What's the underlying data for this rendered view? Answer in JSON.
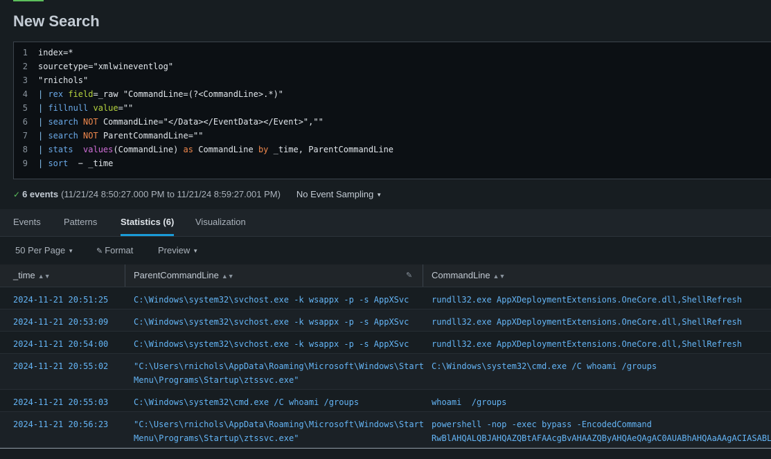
{
  "page": {
    "title": "New Search"
  },
  "query_lines": [
    [
      {
        "t": "index=*",
        "c": "tk-plain"
      }
    ],
    [
      {
        "t": "sourcetype=\"xmlwineventlog\"",
        "c": "tk-plain"
      }
    ],
    [
      {
        "t": "\"rnichols\"",
        "c": "tk-plain"
      }
    ],
    [
      {
        "t": "| ",
        "c": "tk-pipe"
      },
      {
        "t": "rex ",
        "c": "tk-cmd"
      },
      {
        "t": "field",
        "c": "tk-arg"
      },
      {
        "t": "=_raw \"CommandLine=(?<CommandLine>.*)\"",
        "c": "tk-plain"
      }
    ],
    [
      {
        "t": "| ",
        "c": "tk-pipe"
      },
      {
        "t": "fillnull ",
        "c": "tk-cmd"
      },
      {
        "t": "value",
        "c": "tk-arg"
      },
      {
        "t": "=\"\"",
        "c": "tk-plain"
      }
    ],
    [
      {
        "t": "| ",
        "c": "tk-pipe"
      },
      {
        "t": "search ",
        "c": "tk-cmd"
      },
      {
        "t": "NOT ",
        "c": "tk-kw"
      },
      {
        "t": "CommandLine=\"</Data></EventData></Event>\",\"\"",
        "c": "tk-plain"
      }
    ],
    [
      {
        "t": "| ",
        "c": "tk-pipe"
      },
      {
        "t": "search ",
        "c": "tk-cmd"
      },
      {
        "t": "NOT ",
        "c": "tk-kw"
      },
      {
        "t": "ParentCommandLine=\"\"",
        "c": "tk-plain"
      }
    ],
    [
      {
        "t": "| ",
        "c": "tk-pipe"
      },
      {
        "t": "stats  ",
        "c": "tk-cmd"
      },
      {
        "t": "values",
        "c": "tk-fn"
      },
      {
        "t": "(CommandLine) ",
        "c": "tk-plain"
      },
      {
        "t": "as ",
        "c": "tk-kw"
      },
      {
        "t": "CommandLine ",
        "c": "tk-plain"
      },
      {
        "t": "by ",
        "c": "tk-kw"
      },
      {
        "t": "_time, ParentCommandLine",
        "c": "tk-plain"
      }
    ],
    [
      {
        "t": "| ",
        "c": "tk-pipe"
      },
      {
        "t": "sort ",
        "c": "tk-cmd"
      },
      {
        "t": " − _time",
        "c": "tk-plain"
      }
    ]
  ],
  "summary": {
    "events": "6 events",
    "range": "(11/21/24 8:50:27.000 PM to 11/21/24 8:59:27.001 PM)",
    "sampling": "No Event Sampling"
  },
  "tabs": [
    "Events",
    "Patterns",
    "Statistics (6)",
    "Visualization"
  ],
  "active_tab": "Statistics (6)",
  "toolbar": {
    "per_page": "50 Per Page",
    "format": "Format",
    "preview": "Preview"
  },
  "table": {
    "columns": [
      "_time",
      "ParentCommandLine",
      "CommandLine"
    ],
    "rows": [
      {
        "time": "2024-11-21 20:51:25",
        "parent": "C:\\Windows\\system32\\svchost.exe -k wsappx -p -s AppXSvc",
        "cmd": "rundll32.exe AppXDeploymentExtensions.OneCore.dll,ShellRefresh"
      },
      {
        "time": "2024-11-21 20:53:09",
        "parent": "C:\\Windows\\system32\\svchost.exe -k wsappx -p -s AppXSvc",
        "cmd": "rundll32.exe AppXDeploymentExtensions.OneCore.dll,ShellRefresh"
      },
      {
        "time": "2024-11-21 20:54:00",
        "parent": "C:\\Windows\\system32\\svchost.exe -k wsappx -p -s AppXSvc",
        "cmd": "rundll32.exe AppXDeploymentExtensions.OneCore.dll,ShellRefresh"
      },
      {
        "time": "2024-11-21 20:55:02",
        "parent": "\"C:\\Users\\rnichols\\AppData\\Roaming\\Microsoft\\Windows\\Start\nMenu\\Programs\\Startup\\ztssvc.exe\"",
        "cmd": "C:\\Windows\\system32\\cmd.exe /C whoami /groups"
      },
      {
        "time": "2024-11-21 20:55:03",
        "parent": "C:\\Windows\\system32\\cmd.exe /C whoami /groups",
        "cmd": "whoami  /groups"
      },
      {
        "time": "2024-11-21 20:56:23",
        "parent": "\"C:\\Users\\rnichols\\AppData\\Roaming\\Microsoft\\Windows\\Start\nMenu\\Programs\\Startup\\ztssvc.exe\"",
        "cmd": "powershell -nop -exec bypass -EncodedCommand\nRwBlAHQALQBJAHQAZQBtAFAAcgBvAHAAZQByAHQAeQAgAC0AUABhAHQAaAAgACIASABLAE"
      }
    ]
  },
  "colors": {
    "accent": "#1a9cd8",
    "link": "#64b5f6",
    "success": "#5cc05c"
  }
}
